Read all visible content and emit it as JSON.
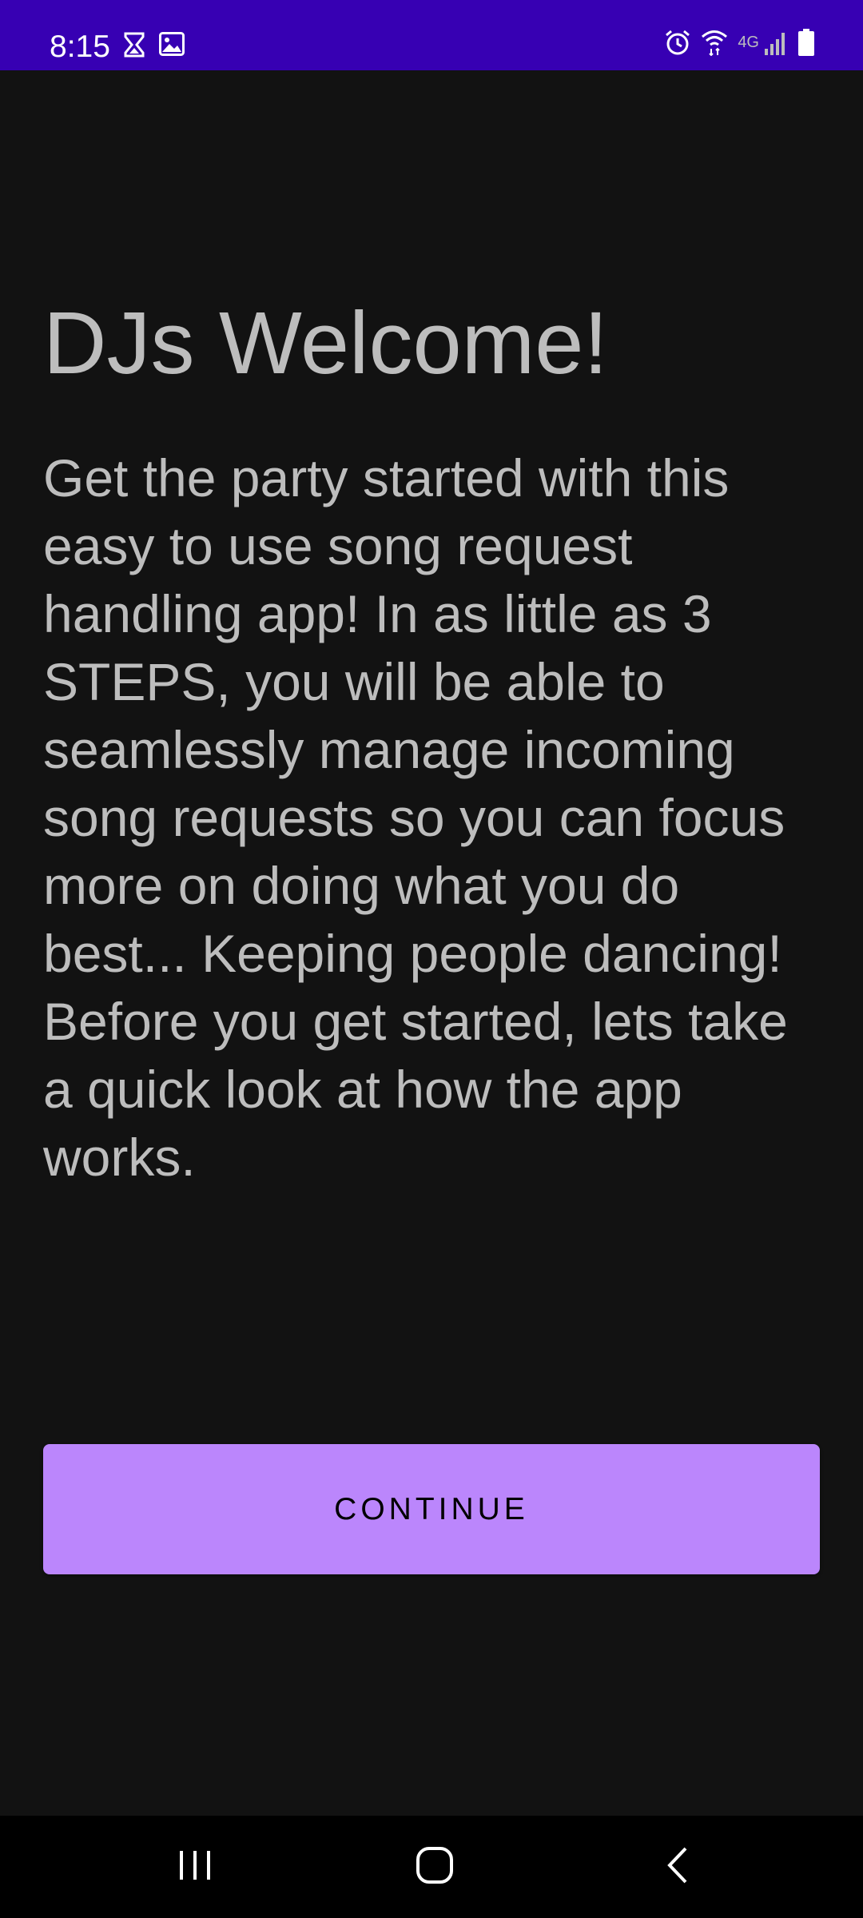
{
  "status_bar": {
    "time": "8:15",
    "network_label": "4G",
    "background_color": "#3700B3",
    "left_icons": [
      "hourglass-icon",
      "image-icon"
    ],
    "right_icons": [
      "alarm-icon",
      "wifi-icon",
      "signal-icon",
      "battery-icon"
    ]
  },
  "main": {
    "title": "DJs Welcome!",
    "description": "Get the party started with this easy to use song request handling app! In as little as 3 STEPS, you will be able to seamlessly manage incoming song requests so you can focus more on doing what you do best... Keeping people dancing! Before you get started, lets take a quick look at how the app works.",
    "continue_label": "CONTINUE",
    "button_color": "#BB86FC",
    "background_color": "#121212",
    "text_color": "#BDBDBD"
  },
  "nav_bar": {
    "icons": [
      "recent-apps-icon",
      "home-icon",
      "back-icon"
    ]
  }
}
